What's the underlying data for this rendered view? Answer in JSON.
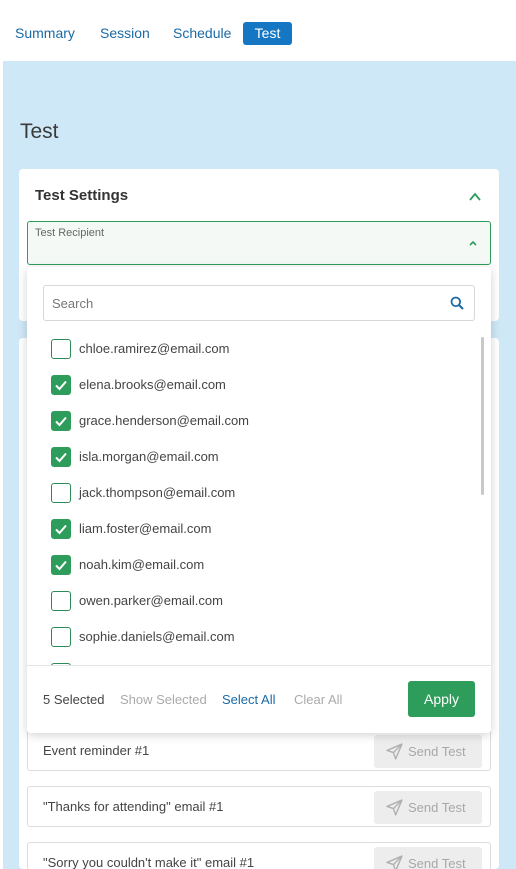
{
  "tabs": [
    {
      "label": "Summary",
      "active": false
    },
    {
      "label": "Session",
      "active": false
    },
    {
      "label": "Schedule",
      "active": false
    },
    {
      "label": "Test",
      "active": true
    }
  ],
  "page": {
    "title": "Test"
  },
  "test_settings": {
    "title": "Test Settings",
    "recipient_label": "Test Recipient"
  },
  "dropdown": {
    "search_placeholder": "Search",
    "recipients": [
      {
        "email": "chloe.ramirez@email.com",
        "checked": false
      },
      {
        "email": "elena.brooks@email.com",
        "checked": true
      },
      {
        "email": "grace.henderson@email.com",
        "checked": true
      },
      {
        "email": "isla.morgan@email.com",
        "checked": true
      },
      {
        "email": "jack.thompson@email.com",
        "checked": false
      },
      {
        "email": "liam.foster@email.com",
        "checked": true
      },
      {
        "email": "noah.kim@email.com",
        "checked": true
      },
      {
        "email": "owen.parker@email.com",
        "checked": false
      },
      {
        "email": "sophie.daniels@email.com",
        "checked": false
      },
      {
        "email": "",
        "checked": false
      }
    ],
    "footer": {
      "selected_count": "5 Selected",
      "show_selected": "Show Selected",
      "select_all": "Select All",
      "clear_all": "Clear All",
      "apply": "Apply"
    }
  },
  "emails": [
    {
      "name": "Event reminder #1",
      "action": "Send Test"
    },
    {
      "name": "\"Thanks for attending\" email #1",
      "action": "Send Test"
    },
    {
      "name": "\"Sorry you couldn't make it\" email #1",
      "action": "Send Test"
    }
  ],
  "colors": {
    "accent_blue": "#1577c4",
    "accent_green": "#2e9c5a",
    "background": "#cfe8f7"
  }
}
